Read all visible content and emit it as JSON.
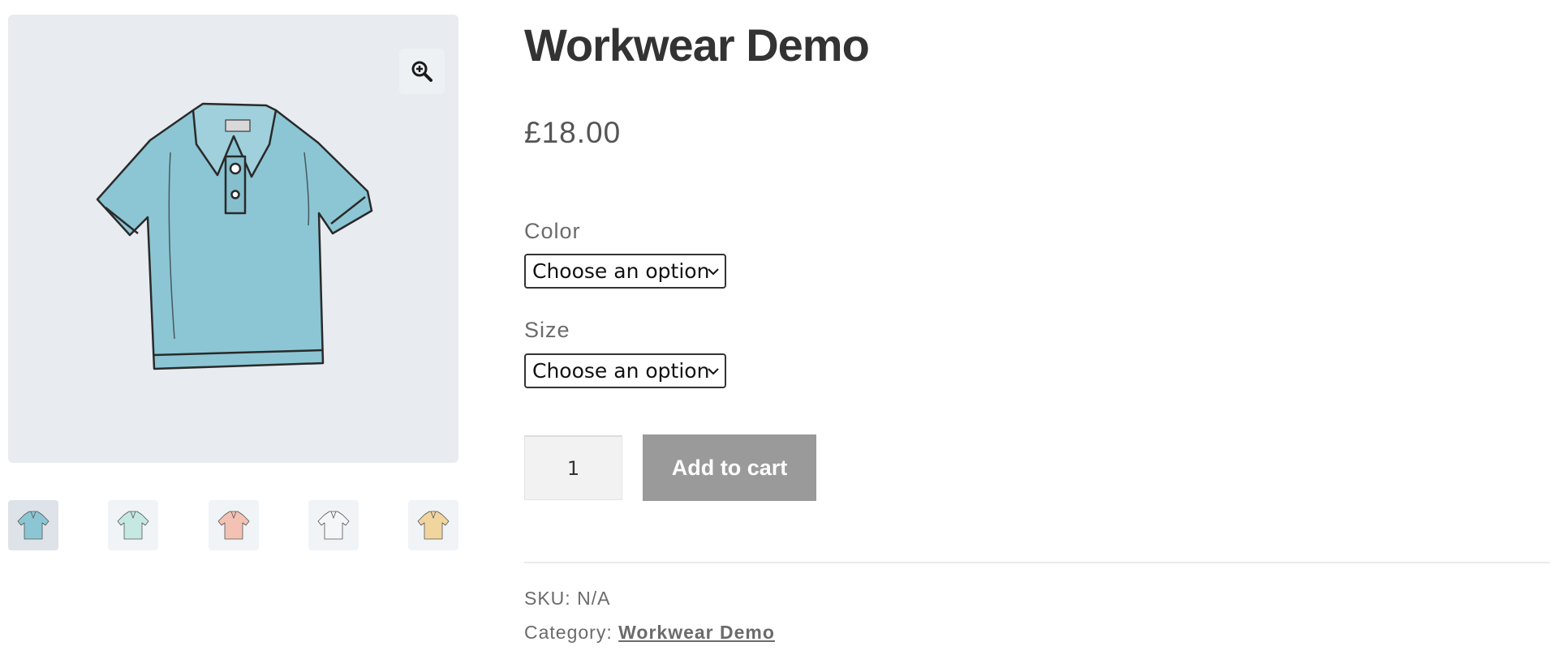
{
  "product": {
    "title": "Workwear Demo",
    "price": "£18.00"
  },
  "gallery": {
    "zoom_icon": "zoom-in-icon",
    "main_image": "blue-polo-shirt",
    "thumbnails": [
      {
        "name": "thumbnail-blue",
        "color": "#8cc6d4",
        "active": true
      },
      {
        "name": "thumbnail-mint",
        "color": "#c6e8e2",
        "active": false
      },
      {
        "name": "thumbnail-pink",
        "color": "#f3c2b4",
        "active": false
      },
      {
        "name": "thumbnail-white",
        "color": "#f4f6f8",
        "active": false
      },
      {
        "name": "thumbnail-yellow",
        "color": "#f1d59f",
        "active": false
      }
    ]
  },
  "variations": {
    "color": {
      "label": "Color",
      "selected": "Choose an option"
    },
    "size": {
      "label": "Size",
      "selected": "Choose an option"
    }
  },
  "cart": {
    "quantity": "1",
    "add_label": "Add to cart"
  },
  "meta": {
    "sku_label": "SKU:",
    "sku_value": "N/A",
    "category_label": "Category:",
    "category_value": "Workwear Demo"
  },
  "colors": {
    "button_disabled": "#9a9a9a",
    "shirt_blue": "#8cc6d4"
  }
}
